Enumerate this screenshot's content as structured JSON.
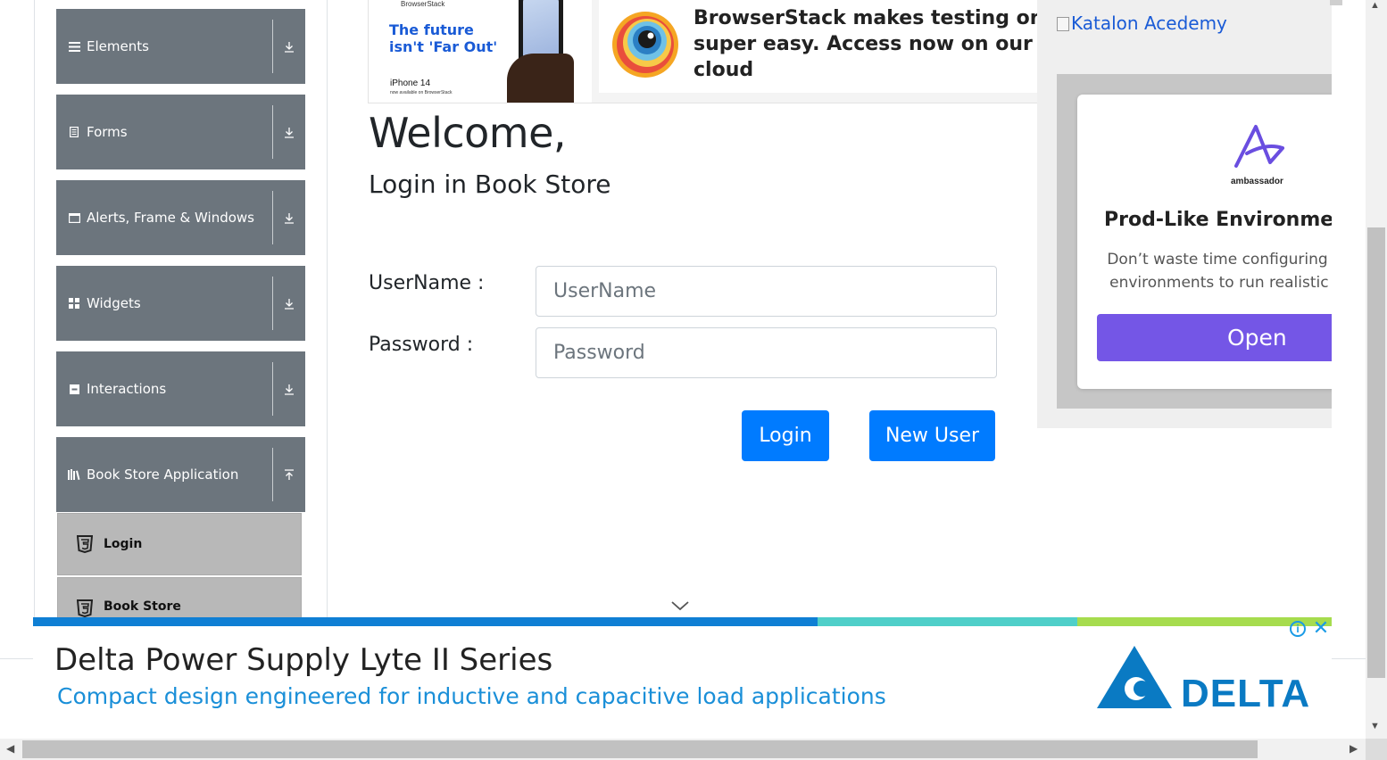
{
  "sidebar": {
    "groups": [
      {
        "label": "Elements",
        "icon": "menu-icon",
        "arrow": "download-icon"
      },
      {
        "label": "Forms",
        "icon": "document-icon",
        "arrow": "download-icon"
      },
      {
        "label": "Alerts, Frame & Windows",
        "icon": "window-icon",
        "arrow": "download-icon"
      },
      {
        "label": "Widgets",
        "icon": "grid-icon",
        "arrow": "download-icon"
      },
      {
        "label": "Interactions",
        "icon": "interactions-icon",
        "arrow": "download-icon"
      },
      {
        "label": "Book Store Application",
        "icon": "books-icon",
        "arrow": "upload-icon"
      }
    ],
    "sub_items": [
      {
        "label": "Login",
        "icon": "html5-icon"
      },
      {
        "label": "Book Store",
        "icon": "html5-icon"
      }
    ]
  },
  "top_ad": {
    "brand_small": "BrowserStack",
    "tagline_line1": "The future",
    "tagline_line2": "isn't 'Far Out'",
    "iphone": "iPhone 14",
    "available": "now available on BrowserStack",
    "headline_line1": "BrowserStack makes testing on iPho",
    "headline_line2": "super easy. Access now on our real",
    "headline_line3": "cloud"
  },
  "main": {
    "welcome": "Welcome,",
    "subtitle": "Login in Book Store",
    "username_label": "UserName :",
    "username_placeholder": "UserName",
    "username_value": "",
    "password_label": "Password :",
    "password_placeholder": "Password",
    "password_value": "",
    "login_button": "Login",
    "new_user_button": "New User"
  },
  "right_ad": {
    "header_alt": "Katalon Acedemy",
    "brand": "ambassador",
    "card_title": "Prod-Like Environments for",
    "card_desc_line1": "Don’t waste time configuring prod",
    "card_desc_line2": "environments to run realistic loca",
    "open_button": "Open"
  },
  "bottom_ad": {
    "title": "Delta Power Supply Lyte II Series",
    "subtitle": "Compact design engineered for inductive and capacitive load applications",
    "brand": "DELTA",
    "info_label": "i",
    "close_label": "✕"
  },
  "colors": {
    "sidebar_bg": "#6c757d",
    "sub_item_bg": "#b8b8b8",
    "primary": "#007bff",
    "ad_open": "#7456e6",
    "progress_blue": "#0f7fd4",
    "progress_teal": "#4fcfc9",
    "progress_green": "#a6dc4e"
  },
  "scrollbars": {
    "up": "▲",
    "down": "▼",
    "left": "◀",
    "right": "▶"
  }
}
